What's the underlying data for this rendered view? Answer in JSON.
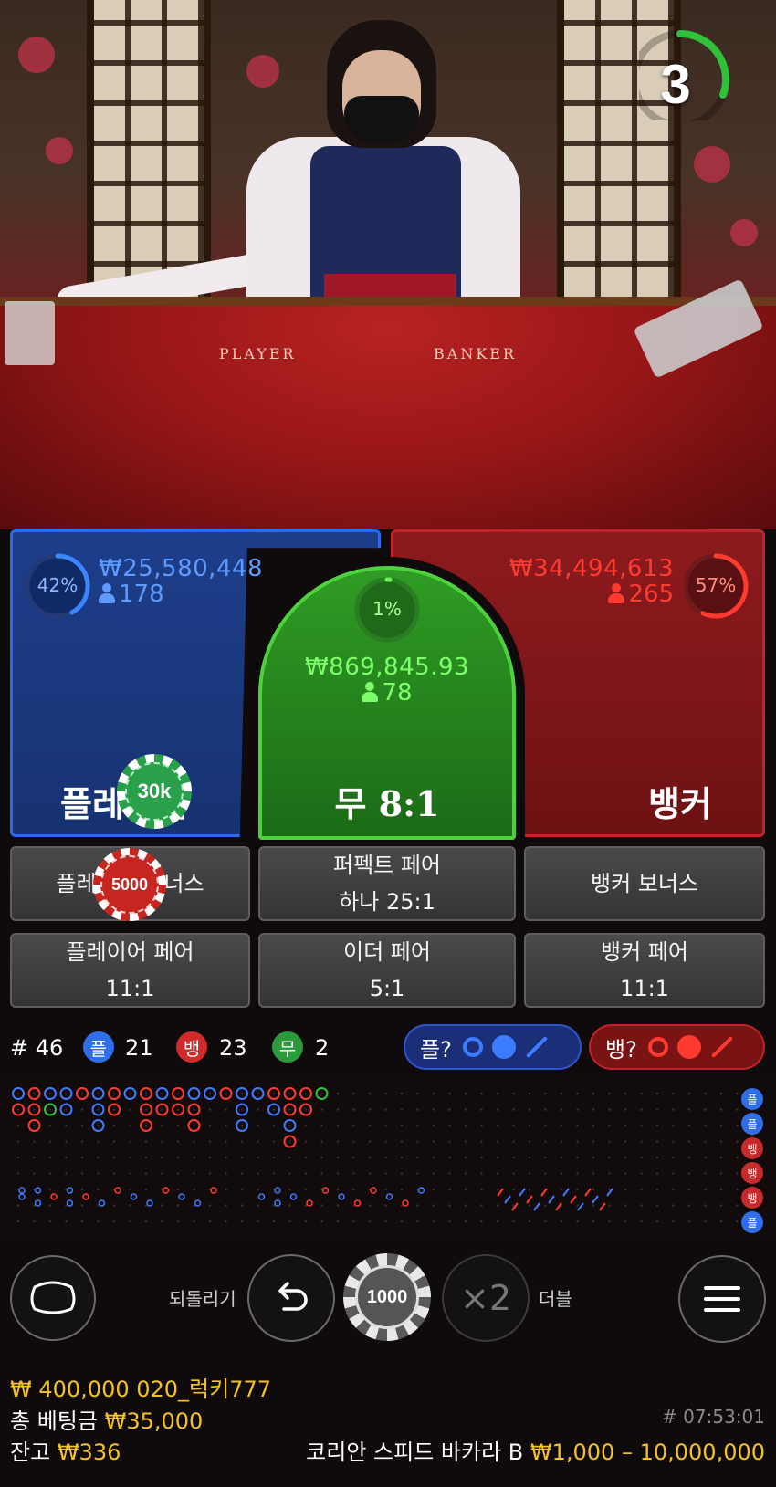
{
  "video": {
    "countdown": "3",
    "felt_player": "PLAYER",
    "felt_banker": "BANKER"
  },
  "player": {
    "percent": "42%",
    "amount": "₩25,580,448",
    "count": "178",
    "label": "플레이어",
    "chip": "30k",
    "color": "#2c6ae8",
    "ratio": 0.42
  },
  "tie": {
    "percent": "1%",
    "amount": "₩869,845.93",
    "count": "78",
    "label": "무 8:1",
    "color": "#4cd23c",
    "ratio": 0.01
  },
  "banker": {
    "percent": "57%",
    "amount": "₩34,494,613",
    "count": "265",
    "label": "뱅커",
    "color": "#e0262a",
    "ratio": 0.57
  },
  "side_bets": {
    "player_bonus": {
      "line1": "플레이어 보너스",
      "chip": "5000"
    },
    "perfect_pair": {
      "line1": "퍼펙트 페어",
      "line2": "하나 25:1"
    },
    "banker_bonus": {
      "line1": "뱅커 보너스"
    },
    "player_pair": {
      "line1": "플레이어 페어",
      "line2": "11:1"
    },
    "either_pair": {
      "line1": "이더 페어",
      "line2": "5:1"
    },
    "banker_pair": {
      "line1": "뱅커 페어",
      "line2": "11:1"
    }
  },
  "stats": {
    "rounds": "# 46",
    "player_badge": "플",
    "player_wins": "21",
    "banker_badge": "뱅",
    "banker_wins": "23",
    "tie_badge": "무",
    "ties": "2",
    "ask_player": "플?",
    "ask_banker": "뱅?"
  },
  "road_side_badges": [
    "플",
    "플",
    "뱅",
    "뱅",
    "뱅",
    "플"
  ],
  "bead_road": [
    [
      "P",
      "B",
      "P",
      "P",
      "B",
      "P",
      "B",
      "P",
      "B",
      "P",
      "B",
      "P",
      "P",
      "B",
      "P",
      "P",
      "B",
      "B",
      "B",
      "T"
    ],
    [
      "B",
      "B",
      "T",
      "P",
      "",
      "P",
      "B",
      "",
      "B",
      "B",
      "B",
      "B",
      "",
      "",
      "P",
      "",
      "P",
      "B",
      "B",
      ""
    ],
    [
      "",
      "B",
      "",
      "",
      "",
      "P",
      "",
      "",
      "B",
      "",
      "",
      "B",
      "",
      "",
      "P",
      "",
      "",
      "P",
      "",
      ""
    ],
    [
      "",
      "",
      "",
      "",
      "",
      "",
      "",
      "",
      "",
      "",
      "",
      "",
      "",
      "",
      "",
      "",
      "",
      "B",
      "",
      ""
    ]
  ],
  "controls": {
    "undo_label": "되돌리기",
    "chip_value": "1000",
    "double_icon": "×2",
    "double_label": "더블"
  },
  "footer": {
    "balance_line": "₩ 400,000 020_럭키777",
    "total_bet_label": "총 베팅금",
    "total_bet_value": "₩35,000",
    "balance_label": "잔고",
    "balance_value": "₩336",
    "round_id": "# 07:53:01",
    "table_name": "코리안 스피드 바카라 B",
    "limits": "₩1,000 – 10,000,000"
  }
}
